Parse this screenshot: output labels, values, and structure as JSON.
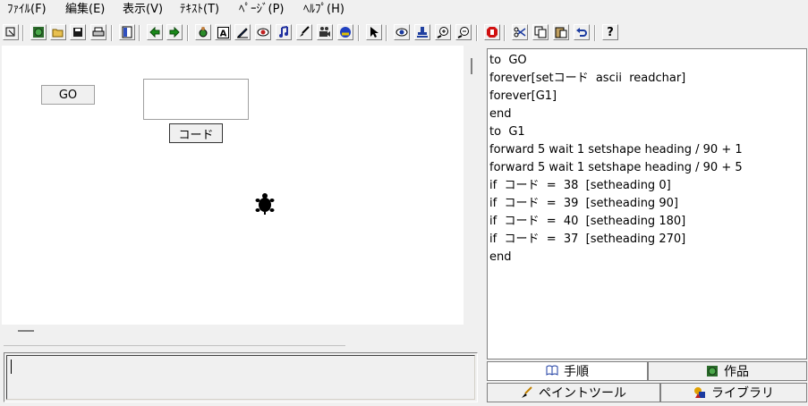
{
  "menu": [
    "ﾌｧｲﾙ(F)",
    "編集(E)",
    "表示(V)",
    "ﾃｷｽﾄ(T)",
    "ﾍﾟｰｼﾞ(P)",
    "ﾍﾙﾌﾟ(H)"
  ],
  "toolbar": {
    "icons": [
      "select-mode-icon",
      "globe-icon",
      "open-folder-icon",
      "save-disk-icon",
      "print-icon",
      "page-layout-icon",
      "back-arrow-icon",
      "forward-arrow-icon",
      "turtle-hand-icon",
      "text-box-icon",
      "pen-icon",
      "eye-shape-icon",
      "music-note-icon",
      "brush-icon",
      "video-camera-icon",
      "sound-icon",
      "pointer-icon",
      "eye-icon",
      "stamp-icon",
      "zoom-in-icon",
      "zoom-out-icon",
      "stop-hand-icon",
      "scissors-icon",
      "copy-icon",
      "paste-icon",
      "undo-icon"
    ],
    "help_label": "?"
  },
  "canvas": {
    "go_button_label": "GO",
    "code_button_label": "コード"
  },
  "code": [
    "to  GO",
    "forever[setコード  ascii  readchar]",
    "forever[G1]",
    "end",
    "to  G1",
    "forward 5 wait 1 setshape heading / 90 + 1",
    "forward 5 wait 1 setshape heading / 90 + 5",
    "if  コード  =  38  [setheading 0]",
    "if  コード  =  39  [setheading 90]",
    "if  コード  =  40  [setheading 180]",
    "if  コード  =  37  [setheading 270]",
    "end"
  ],
  "tabs": {
    "procedures": "手順",
    "works": "作品",
    "paint_tool": "ペイントツール",
    "library": "ライブラリ"
  }
}
